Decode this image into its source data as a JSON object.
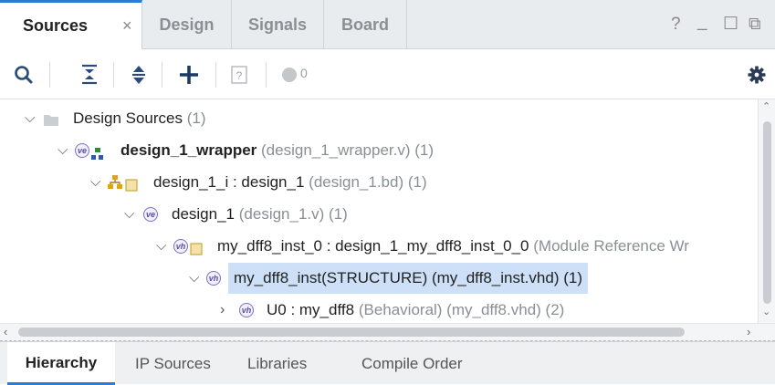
{
  "tabs": {
    "sources": "Sources",
    "close_glyph": "×",
    "design": "Design",
    "signals": "Signals",
    "board": "Board"
  },
  "window_controls": {
    "help": "?",
    "minimize": "_",
    "maximize": "☐",
    "restore": "⧉"
  },
  "toolbar": {
    "messages_count": "0"
  },
  "tree": {
    "rows": [
      {
        "name": "Design Sources",
        "suffix": "(1)"
      },
      {
        "name": "design_1_wrapper",
        "suffix": "(design_1_wrapper.v) (1)",
        "badge": "ve"
      },
      {
        "name": "design_1_i : design_1",
        "suffix": "(design_1.bd) (1)"
      },
      {
        "name": "design_1",
        "suffix": "(design_1.v) (1)",
        "badge": "ve"
      },
      {
        "name": "my_dff8_inst_0 : design_1_my_dff8_inst_0_0",
        "suffix": "(Module Reference Wr",
        "badge": "vh"
      },
      {
        "name": "my_dff8_inst(STRUCTURE) (my_dff8_inst.vhd) (1)",
        "badge": "vh"
      },
      {
        "name": "U0 : my_dff8",
        "suffix": "(Behavioral) (my_dff8.vhd) (2)",
        "badge": "vh"
      }
    ]
  },
  "bottom_tabs": {
    "hierarchy": "Hierarchy",
    "ip_sources": "IP Sources",
    "libraries": "Libraries",
    "compile_order": "Compile Order"
  },
  "colors": {
    "accent": "#2c7bd4",
    "selection": "#cde0f7",
    "verilog_badge": "#7d6fc4"
  }
}
